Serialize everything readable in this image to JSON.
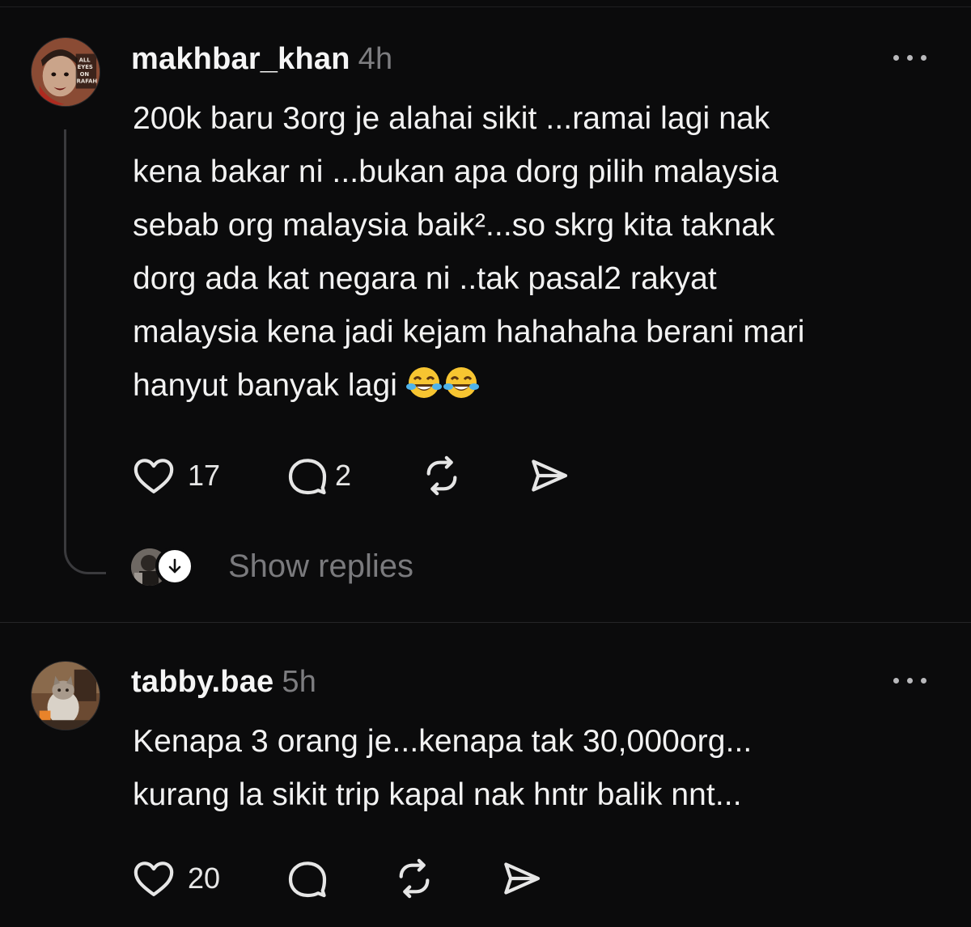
{
  "posts": [
    {
      "username": "makhbar_khan",
      "time": "4h",
      "avatar_icon": "protest-poster-avatar",
      "text_lines": [
        "200k baru 3org je alahai sikit ...ramai lagi nak",
        "kena bakar ni ...bukan apa dorg pilih malaysia",
        "sebab org malaysia baik²...so skrg kita taknak",
        "dorg ada kat negara ni ..tak pasal2 rakyat",
        "malaysia kena jadi kejam hahahaha berani mari",
        "hanyut banyak lagi"
      ],
      "emoji": [
        "face-with-tears-of-joy",
        "face-with-tears-of-joy"
      ],
      "likes": "17",
      "replies": "2",
      "show_replies_label": "Show replies"
    },
    {
      "username": "tabby.bae",
      "time": "5h",
      "avatar_icon": "cat-photo-avatar",
      "text_lines": [
        "Kenapa 3 orang je...kenapa tak 30,000org...",
        "kurang la sikit trip kapal nak hntr balik nnt..."
      ],
      "likes": "20"
    }
  ],
  "colors": {
    "background": "#0b0b0c",
    "text": "#f2f2f2",
    "muted": "#7d7d80",
    "divider": "#252527"
  }
}
